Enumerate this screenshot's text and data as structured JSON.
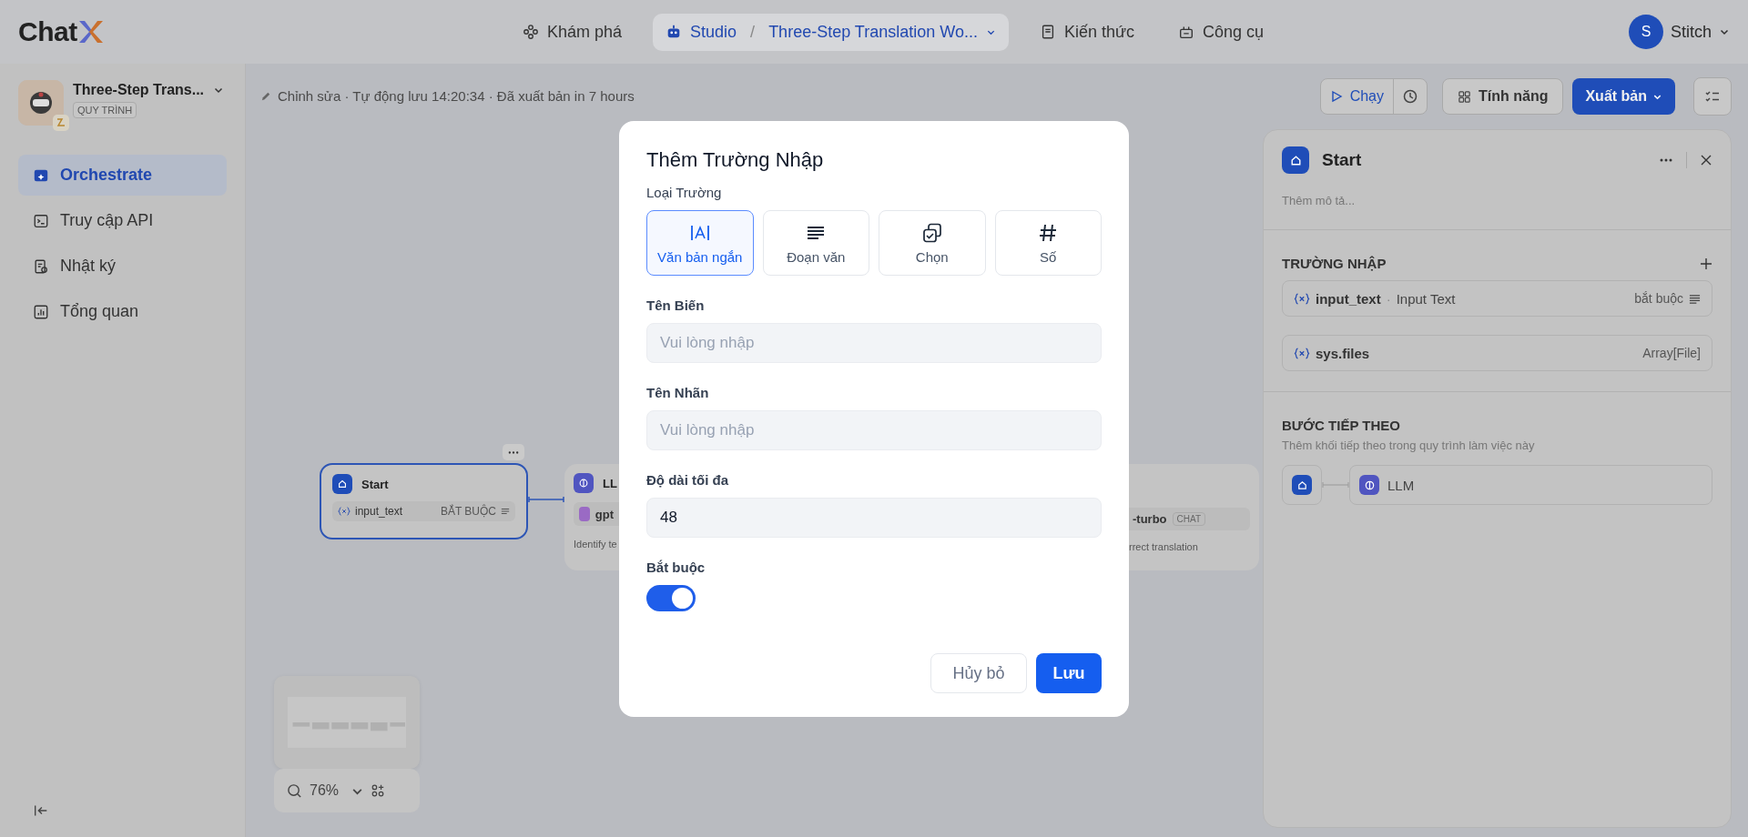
{
  "logo": {
    "text": "Chat"
  },
  "top_nav": [
    {
      "label": "Khám phá",
      "selected": false
    },
    {
      "label": "Studio",
      "selected": true,
      "separator": "/",
      "breadcrumb": "Three-Step Translation Wo..."
    },
    {
      "label": "Kiến thức",
      "selected": false
    },
    {
      "label": "Công cụ",
      "selected": false
    }
  ],
  "user": {
    "initial": "S",
    "name": "Stitch"
  },
  "app": {
    "name": "Three-Step Trans...",
    "type": "QUY TRÌNH"
  },
  "sidebar": {
    "items": [
      {
        "label": "Orchestrate",
        "selected": true
      },
      {
        "label": "Truy cập API",
        "selected": false
      },
      {
        "label": "Nhật ký",
        "selected": false
      },
      {
        "label": "Tổng quan",
        "selected": false
      }
    ]
  },
  "toolbar": {
    "status": "Chỉnh sửa · Tự động lưu 14:20:34 · Đã xuất bản in 7 hours",
    "run": "Chạy",
    "features": "Tính năng",
    "publish": "Xuất bản"
  },
  "canvas": {
    "start_node": {
      "title": "Start",
      "variable": "input_text",
      "badge": "BẮT BUỘC",
      "selected": true
    },
    "llm_node": {
      "title": "LL",
      "model": "gpt",
      "description": "Identify te"
    },
    "right_node": {
      "model": "-turbo",
      "tag": "CHAT",
      "description": "rrect translation"
    },
    "zoom": "76%"
  },
  "panel": {
    "title": "Start",
    "description_placeholder": "Thêm mô tả...",
    "inputs_heading": "TRƯỜNG NHẬP",
    "variables": [
      {
        "name": "input_text",
        "separator": "·",
        "label": "Input Text",
        "type": "bắt buộc"
      },
      {
        "name": "sys.files",
        "type": "Array[File]"
      }
    ],
    "next_heading": "BƯỚC TIẾP THEO",
    "next_hint": "Thêm khối tiếp theo trong quy trình làm việc này",
    "next_block": "LLM"
  },
  "dialog": {
    "title": "Thêm Trường Nhập",
    "type_label": "Loại Trường",
    "types": [
      {
        "label": "Văn bản ngắn",
        "selected": true
      },
      {
        "label": "Đoạn văn",
        "selected": false
      },
      {
        "label": "Chọn",
        "selected": false
      },
      {
        "label": "Số",
        "selected": false
      }
    ],
    "variable_label": "Tên Biến",
    "variable_placeholder": "Vui lòng nhập",
    "display_label": "Tên Nhãn",
    "display_placeholder": "Vui lòng nhập",
    "max_length_label": "Độ dài tối đa",
    "max_length": "48",
    "required": {
      "label": "Bắt buộc",
      "on": true
    },
    "cancel": "Hủy bỏ",
    "save": "Lưu"
  }
}
